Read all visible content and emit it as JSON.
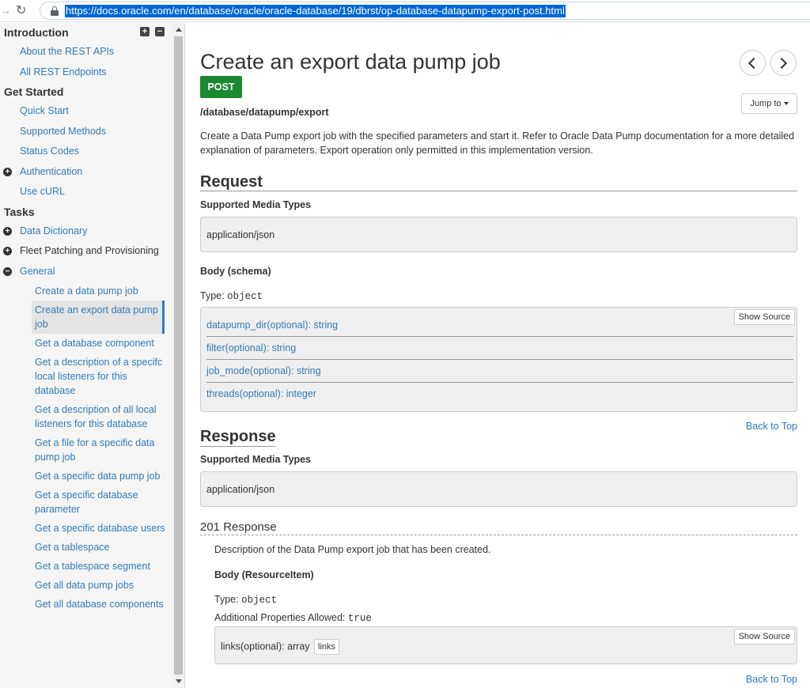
{
  "browser": {
    "url": "https://docs.oracle.com/en/database/oracle/oracle-database/19/dbrst/op-database-datapump-export-post.html"
  },
  "sidebar": {
    "introduction": {
      "title": "Introduction",
      "items": [
        "About the REST APIs",
        "All REST Endpoints"
      ]
    },
    "get_started": {
      "title": "Get Started",
      "items": [
        "Quick Start",
        "Supported Methods",
        "Status Codes"
      ],
      "auth": "Authentication",
      "curl": "Use cURL"
    },
    "tasks": {
      "title": "Tasks",
      "data_dictionary": "Data Dictionary",
      "fleet": "Fleet Patching and Provisioning",
      "general": "General",
      "general_items": [
        "Create a data pump job",
        "Create an export data pump job",
        "Get a database component",
        "Get a description of a specifc local listeners for this database",
        "Get a description of all local listeners for this database",
        "Get a file for a specific data pump job",
        "Get a specific data pump job",
        "Get a specific database parameter",
        "Get a specific database users",
        "Get a tablespace",
        "Get a tablespace segment",
        "Get all data pump jobs",
        "Get all database components"
      ]
    }
  },
  "main": {
    "title": "Create an export data pump job",
    "method": "POST",
    "endpoint": "/database/datapump/export",
    "jump_to": "Jump to",
    "description": "Create a Data Pump export job with the specified parameters and start it. Refer to Oracle Data Pump documentation for a more detailed explanation of parameters. Export operation only permitted in this implementation version.",
    "request": {
      "heading": "Request",
      "media_label": "Supported Media Types",
      "media_value": "application/json",
      "body_label": "Body (schema)",
      "type_label": "Type:",
      "type_value": "object",
      "show_source": "Show Source",
      "properties": [
        "datapump_dir(optional): string",
        "filter(optional): string",
        "job_mode(optional): string",
        "threads(optional): integer"
      ],
      "back_to_top": "Back to Top"
    },
    "response": {
      "heading": "Response",
      "media_label": "Supported Media Types",
      "media_value": "application/json",
      "code": "201 Response",
      "code_desc": "Description of the Data Pump export job that has been created.",
      "body_label": "Body (ResourceItem)",
      "type_label": "Type:",
      "type_value": "object",
      "additional_label": "Additional Properties Allowed:",
      "additional_value": "true",
      "show_source": "Show Source",
      "links_prop": "links(optional): array",
      "links_btn": "links",
      "back_to_top": "Back to Top"
    }
  }
}
